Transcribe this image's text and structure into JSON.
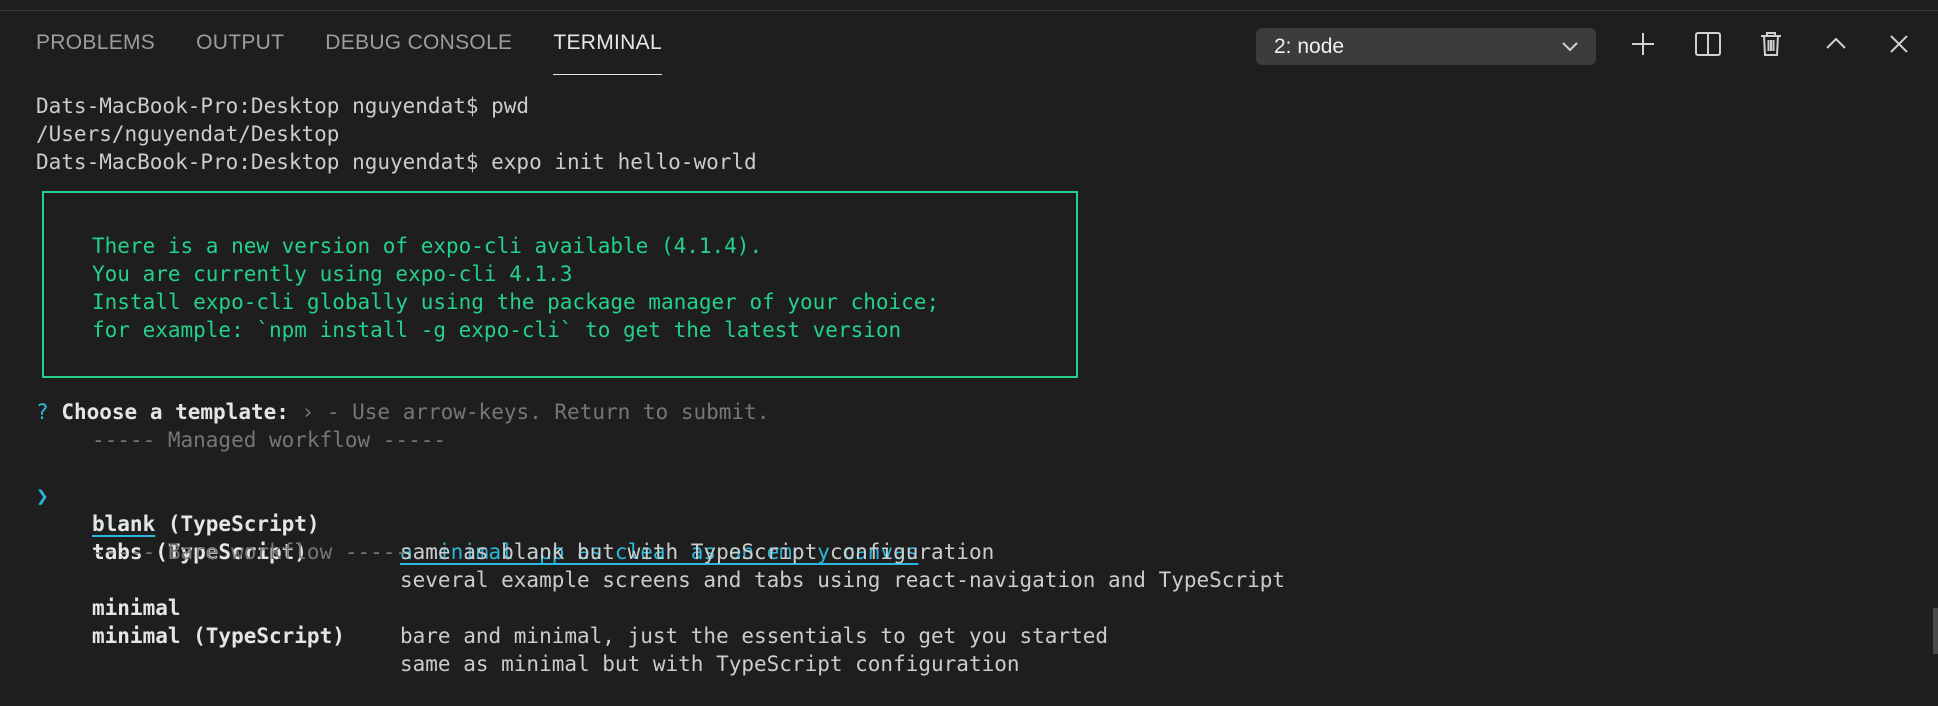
{
  "tabs": [
    {
      "label": "PROBLEMS",
      "active": false
    },
    {
      "label": "OUTPUT",
      "active": false
    },
    {
      "label": "DEBUG CONSOLE",
      "active": false
    },
    {
      "label": "TERMINAL",
      "active": true
    }
  ],
  "terminal_select": {
    "value": "2: node",
    "icon": "chevron-down-icon"
  },
  "actions": [
    {
      "name": "new-terminal-button",
      "icon": "plus-icon"
    },
    {
      "name": "split-terminal-button",
      "icon": "split-icon"
    },
    {
      "name": "kill-terminal-button",
      "icon": "trash-icon"
    },
    {
      "name": "maximize-panel-button",
      "icon": "chevron-up-icon"
    },
    {
      "name": "close-panel-button",
      "icon": "close-icon"
    }
  ],
  "colors": {
    "background": "#1e1e1e",
    "notice_green": "#23d18b",
    "selection_cyan": "#29b8db",
    "dim_text": "#767676"
  },
  "terminal": {
    "lines": [
      "Dats-MacBook-Pro:Desktop nguyendat$ pwd",
      "/Users/nguyendat/Desktop",
      "Dats-MacBook-Pro:Desktop nguyendat$ expo init hello-world"
    ],
    "notice": [
      "There is a new version of expo-cli available (4.1.4).",
      "You are currently using expo-cli 4.1.3",
      "Install expo-cli globally using the package manager of your choice;",
      "for example: `npm install -g expo-cli` to get the latest version"
    ],
    "prompt": {
      "qmark": "?",
      "question": "Choose a template:",
      "hint": "› - Use arrow-keys. Return to submit."
    },
    "managed_header": "----- Managed workflow -----",
    "bare_header": "----- Bare workflow -----",
    "pointer": "❯",
    "templates": [
      {
        "name": "blank",
        "desc": "a minimal app as clean as an empty canvas",
        "selected": true
      },
      {
        "name": "blank (TypeScript)",
        "desc": "same as blank but with TypeScript configuration",
        "selected": false
      },
      {
        "name": "tabs (TypeScript)",
        "desc": "several example screens and tabs using react-navigation and TypeScript",
        "selected": false
      },
      {
        "name": "minimal",
        "desc": "bare and minimal, just the essentials to get you started",
        "selected": false
      },
      {
        "name": "minimal (TypeScript)",
        "desc": "same as minimal but with TypeScript configuration",
        "selected": false
      }
    ]
  }
}
